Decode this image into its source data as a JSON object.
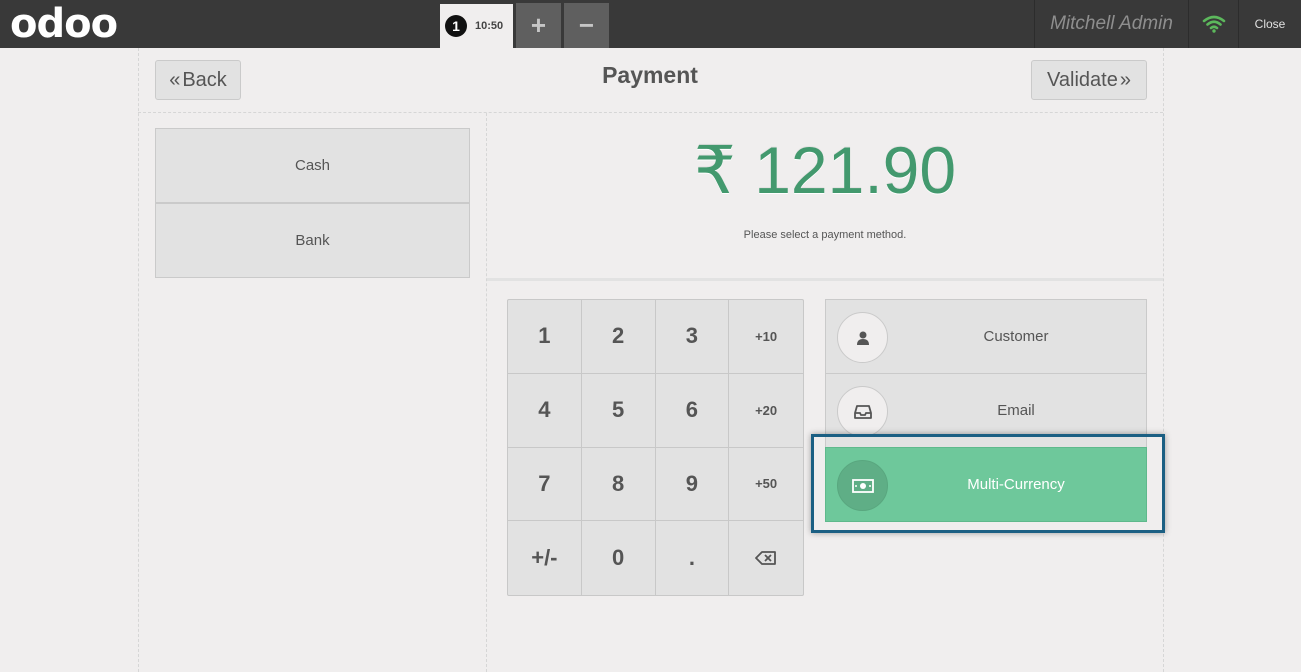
{
  "topbar": {
    "logo": "odoo",
    "order": {
      "number": "1",
      "time": "10:50"
    },
    "add_order_label": "+",
    "remove_order_label": "−",
    "username": "Mitchell Admin",
    "close_label": "Close",
    "wifi_color": "#5cb85c"
  },
  "header": {
    "back_label": "Back",
    "title": "Payment",
    "validate_label": "Validate"
  },
  "payment_methods": [
    "Cash",
    "Bank"
  ],
  "amount": "₹ 121.90",
  "hint": "Please select a payment method.",
  "numpad": [
    "1",
    "2",
    "3",
    "+10",
    "4",
    "5",
    "6",
    "+20",
    "7",
    "8",
    "9",
    "+50",
    "+/-",
    "0",
    ".",
    "backspace"
  ],
  "options": [
    {
      "label": "Customer",
      "icon": "user-icon"
    },
    {
      "label": "Email",
      "icon": "inbox-icon"
    },
    {
      "label": "Multi-Currency",
      "icon": "money-icon",
      "active": true
    }
  ],
  "colors": {
    "accent_green": "#43996e",
    "active_option": "#6ec89b",
    "highlight_border": "#1b5f83"
  }
}
